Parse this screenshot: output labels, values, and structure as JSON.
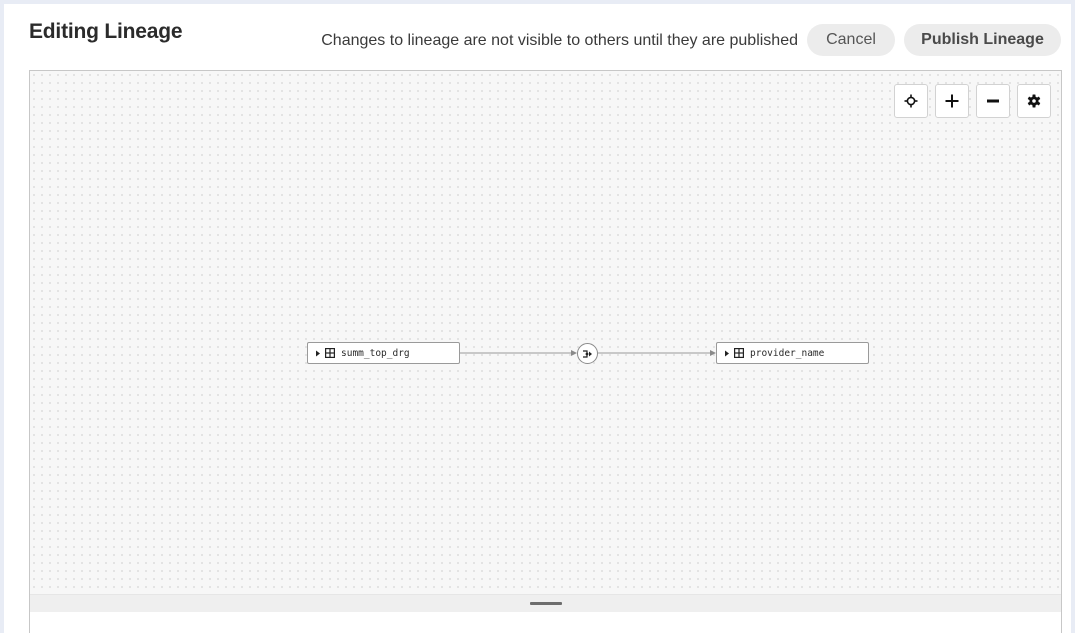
{
  "header": {
    "title": "Editing Lineage",
    "notice": "Changes to lineage are not visible to others until they are published",
    "cancel_label": "Cancel",
    "publish_label": "Publish Lineage"
  },
  "toolbar": {
    "icons": [
      "recenter-icon",
      "zoom-in-icon",
      "zoom-out-icon",
      "settings-icon"
    ]
  },
  "graph": {
    "nodes": [
      {
        "label": "summ_top_drg",
        "icon": "table-icon"
      },
      {
        "label": "provider_name",
        "icon": "table-icon"
      }
    ],
    "operation_icon": "transform-icon"
  },
  "colors": {
    "background": "#e8ecf5",
    "canvas": "#f7f7f7",
    "button_bg": "#ececec",
    "node_border": "#9a9a9a",
    "edge": "#8a8a8a"
  }
}
